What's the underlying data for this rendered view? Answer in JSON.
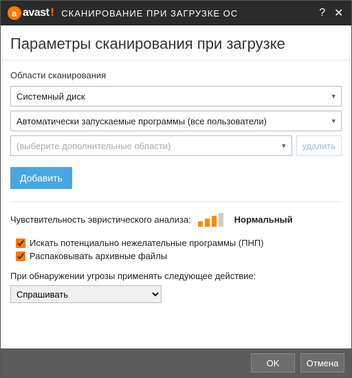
{
  "titlebar": {
    "brand": "avast",
    "brand_excl": "!",
    "title": "СКАНИРОВАНИЕ ПРИ ЗАГРУЗКЕ ОС"
  },
  "header": {
    "title": "Параметры сканирования при загрузке"
  },
  "areas": {
    "label": "Области сканирования",
    "select1": "Системный диск",
    "select2": "Автоматически запускаемые программы (все пользователи)",
    "select3_placeholder": "(выберите дополнительные области)",
    "delete_label": "удалить",
    "add_label": "Добавить"
  },
  "heuristic": {
    "label": "Чувствительность эвристического анализа:",
    "level_label": "Нормальный",
    "level": 3,
    "max": 4
  },
  "checks": {
    "pup": {
      "label": "Искать потенциально нежелательные программы (ПНП)",
      "checked": true
    },
    "unpack": {
      "label": "Распаковывать архивные файлы",
      "checked": true
    }
  },
  "threat_action": {
    "label": "При обнаружении угрозы применять следующее действие:",
    "value": "Спрашивать"
  },
  "footer": {
    "ok": "OK",
    "cancel": "Отмена"
  }
}
